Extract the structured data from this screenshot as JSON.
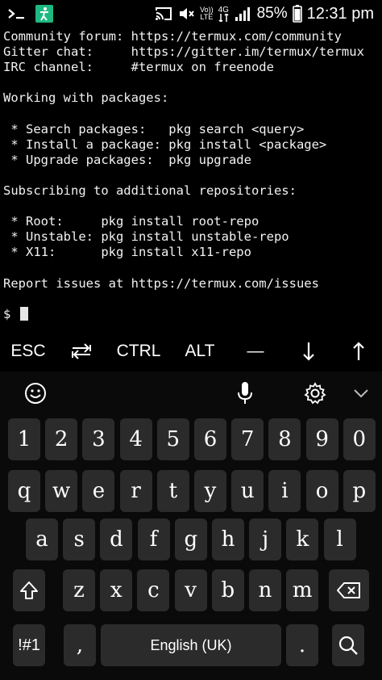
{
  "status_bar": {
    "left_icons": [
      "terminal-prompt-icon",
      "accessibility-icon"
    ],
    "right_icons": [
      "cast-icon",
      "mute-icon",
      "volte-icon",
      "4g-signal-icon",
      "battery-icon"
    ],
    "volte_label_top": "Vo))",
    "volte_label_bottom": "LTE",
    "network_label": "4G",
    "battery": "85%",
    "time": "12:31 pm"
  },
  "terminal": {
    "lines": [
      "Community forum: https://termux.com/community",
      "Gitter chat:     https://gitter.im/termux/termux",
      "IRC channel:     #termux on freenode",
      "",
      "Working with packages:",
      "",
      " * Search packages:   pkg search <query>",
      " * Install a package: pkg install <package>",
      " * Upgrade packages:  pkg upgrade",
      "",
      "Subscribing to additional repositories:",
      "",
      " * Root:     pkg install root-repo",
      " * Unstable: pkg install unstable-repo",
      " * X11:      pkg install x11-repo",
      "",
      "Report issues at https://termux.com/issues",
      ""
    ],
    "prompt": "$ "
  },
  "extra_keys": {
    "esc": "ESC",
    "tab_icon": "tab-arrows-icon",
    "ctrl": "CTRL",
    "alt": "ALT",
    "dash": "—",
    "down_icon": "arrow-down-icon",
    "up_icon": "arrow-up-icon"
  },
  "keyboard": {
    "toolbar_icons": [
      "emoji-icon",
      "microphone-icon",
      "settings-icon",
      "collapse-icon"
    ],
    "row_numbers": [
      "1",
      "2",
      "3",
      "4",
      "5",
      "6",
      "7",
      "8",
      "9",
      "0"
    ],
    "row_top": [
      "q",
      "w",
      "e",
      "r",
      "t",
      "y",
      "u",
      "i",
      "o",
      "p"
    ],
    "row_middle": [
      "a",
      "s",
      "d",
      "f",
      "g",
      "h",
      "j",
      "k",
      "l"
    ],
    "row_bottom": [
      "z",
      "x",
      "c",
      "v",
      "b",
      "n",
      "m"
    ],
    "symbols_key": "!#1",
    "comma_key": ",",
    "space_label": "English (UK)",
    "period_key": ".",
    "shift_icon": "shift-icon",
    "backspace_icon": "backspace-icon",
    "search_icon": "search-icon"
  }
}
